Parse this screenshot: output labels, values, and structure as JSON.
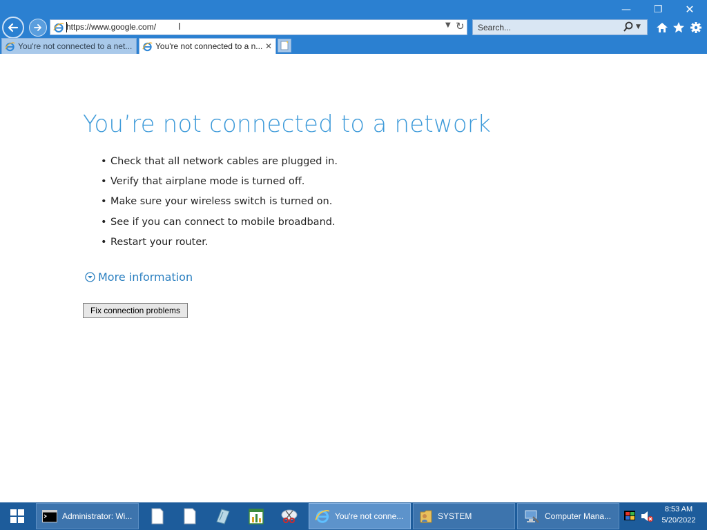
{
  "window": {
    "minimize_glyph": "—",
    "restore_glyph": "❐",
    "close_glyph": "✕"
  },
  "address_bar": {
    "url": "https://www.google.com/",
    "icon": "ie-icon",
    "dropdown_icon": "chevron-down-icon",
    "refresh_icon": "refresh-icon"
  },
  "search_bar": {
    "placeholder": "Search...",
    "search_icon": "magnifier-icon"
  },
  "toolbar_icons": [
    "home-icon",
    "star-icon",
    "gear-icon"
  ],
  "tabs": [
    {
      "label": "You're not connected to a net...",
      "active": false
    },
    {
      "label": "You're not connected to a n...",
      "active": true,
      "close": "✕"
    }
  ],
  "page": {
    "title": "You’re not connected to a network",
    "tips": [
      "Check that all network cables are plugged in.",
      "Verify that airplane mode is turned off.",
      "Make sure your wireless switch is turned on.",
      "See if you can connect to mobile broadband.",
      "Restart your router."
    ],
    "more_info": "More information",
    "fix_button": "Fix connection problems",
    "title_color": "#3d9ad9",
    "link_color": "#2a7fc0"
  },
  "taskbar": {
    "items": [
      {
        "label": "Administrator: Wi...",
        "icon": "cmd-icon"
      },
      {
        "label": "You're not conne...",
        "icon": "ie-icon",
        "active": true
      },
      {
        "label": "SYSTEM",
        "icon": "folder-user-icon"
      },
      {
        "label": "Computer Mana...",
        "icon": "computer-management-icon"
      }
    ],
    "pinned": [
      "document-icon",
      "document-icon",
      "tool-icon",
      "chart-icon",
      "snipping-tool-icon"
    ],
    "clock_time": "8:53 AM",
    "clock_date": "5/20/2022",
    "accent": "#1d5c9b"
  }
}
